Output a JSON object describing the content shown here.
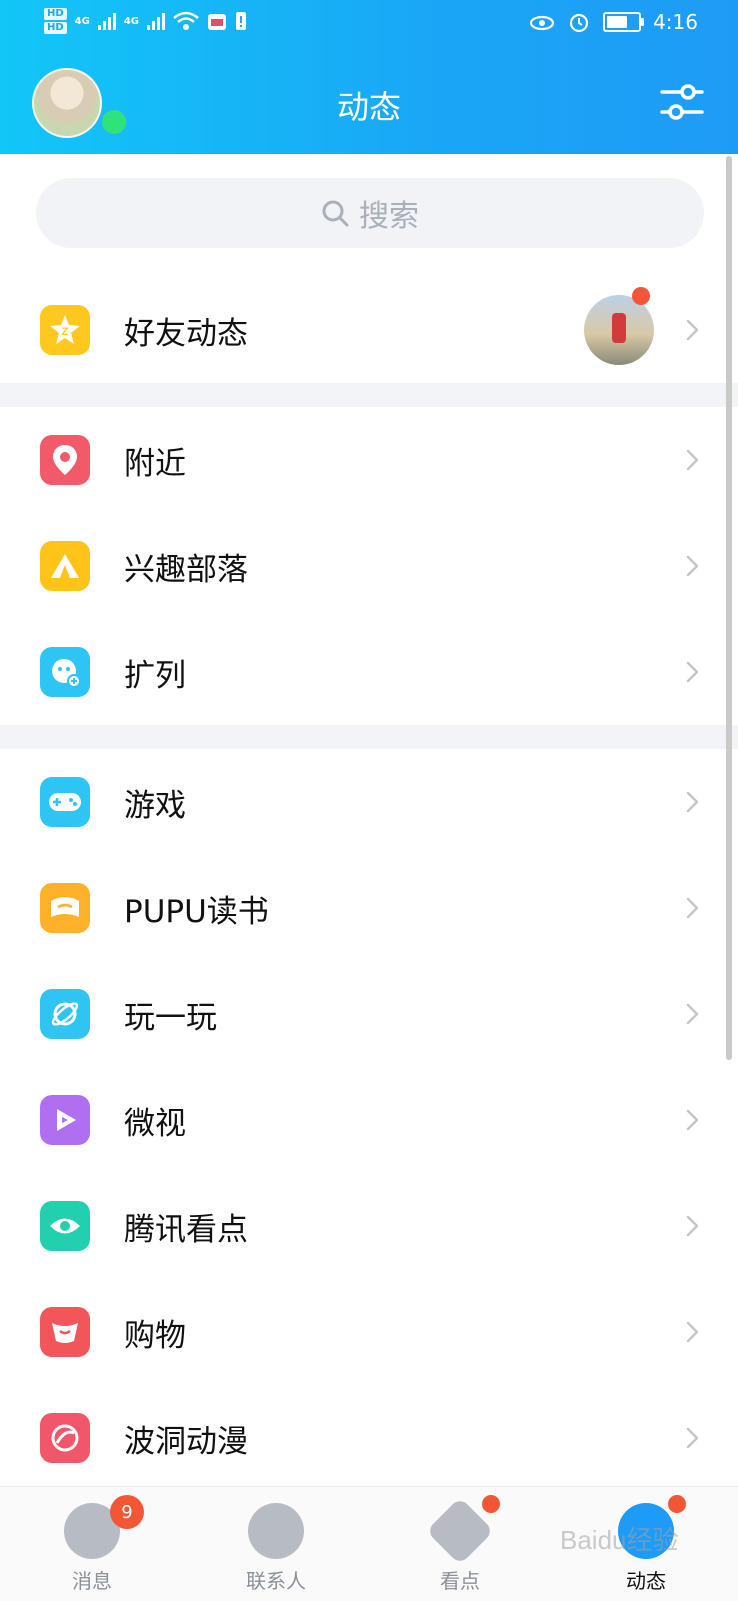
{
  "status_bar": {
    "hd1": "HD",
    "hd2": "HD",
    "net1": "4G",
    "net2": "4G",
    "time": "4:16"
  },
  "header": {
    "title": "动态"
  },
  "search": {
    "placeholder": "搜索"
  },
  "colors": {
    "accent": "#1aa6f6",
    "online": "#2ee37a",
    "badge": "#f25634"
  },
  "menu": {
    "friends_feed": {
      "label": "好友动态",
      "icon": "qzone-star-icon"
    },
    "group1": [
      {
        "label": "附近",
        "icon": "location-pin-icon",
        "color": "#f25a6a"
      },
      {
        "label": "兴趣部落",
        "icon": "tent-icon",
        "color": "#ffc31a"
      },
      {
        "label": "扩列",
        "icon": "add-friend-face-icon",
        "color": "#2ec4f3"
      }
    ],
    "group2": [
      {
        "label": "游戏",
        "icon": "gamepad-icon",
        "color": "#2ec4f3"
      },
      {
        "label": "PUPU读书",
        "icon": "book-icon",
        "color": "#ffb12a"
      },
      {
        "label": "玩一玩",
        "icon": "planet-icon",
        "color": "#2ec4f3"
      },
      {
        "label": "微视",
        "icon": "play-icon",
        "color": "#b06ef0"
      },
      {
        "label": "腾讯看点",
        "icon": "eye-icon",
        "color": "#22cfae"
      },
      {
        "label": "购物",
        "icon": "shopping-icon",
        "color": "#f2565a"
      },
      {
        "label": "波洞动漫",
        "icon": "anime-icon",
        "color": "#f2566a"
      }
    ]
  },
  "tabbar": {
    "tabs": [
      {
        "label": "消息",
        "badge": "9"
      },
      {
        "label": "联系人"
      },
      {
        "label": "看点"
      },
      {
        "label": "动态"
      }
    ]
  },
  "watermark": "Baidu经验"
}
